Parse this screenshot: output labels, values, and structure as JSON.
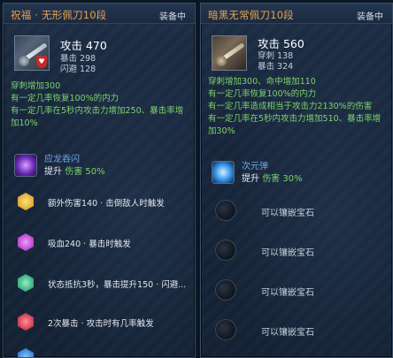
{
  "left": {
    "title": "祝福 · 无形佩刀10段",
    "equipped": "装备中",
    "attack": "攻击 470",
    "stat1": "暴击 298",
    "stat2": "闪避 128",
    "bonus": [
      "穿刺增加300",
      "有一定几率恢复100%的内力",
      "有一定几率在5秒内攻击力增加250、暴击率增",
      "加10%"
    ],
    "skill": {
      "name": "应龙吞闪",
      "desc_prefix": "提升",
      "desc_value": "伤害 50%"
    },
    "gems": [
      {
        "text": "额外伤害140 · 击倒敌人时触发",
        "color": "#f3b62a"
      },
      {
        "text": "吸血240 · 暴击时触发",
        "color": "#c23ad6"
      },
      {
        "text": "状态抵抗3秒，暴击提升150 · 闪避...",
        "color": "#2fc28a"
      },
      {
        "text": "2次暴击 · 攻击时有几率触发",
        "color": "#e0344a"
      }
    ]
  },
  "right": {
    "title": "暗黑无常佩刀10段",
    "equipped": "装备中",
    "attack": "攻击 560",
    "stat1": "穿刺 138",
    "stat2": "暴击 324",
    "bonus": [
      "穿刺增加300、命中增加110",
      "有一定几率恢复100%的内力",
      "有一定几率造成相当于攻击力2130%的伤害",
      "有一定几率在5秒内攻击力增加510、暴击率增",
      "加30%"
    ],
    "skill": {
      "name": "次元弹",
      "desc_prefix": "提升",
      "desc_value": "伤害 30%"
    },
    "empty_slots": [
      "可以镶嵌宝石",
      "可以镶嵌宝石",
      "可以镶嵌宝石",
      "可以镶嵌宝石"
    ]
  }
}
